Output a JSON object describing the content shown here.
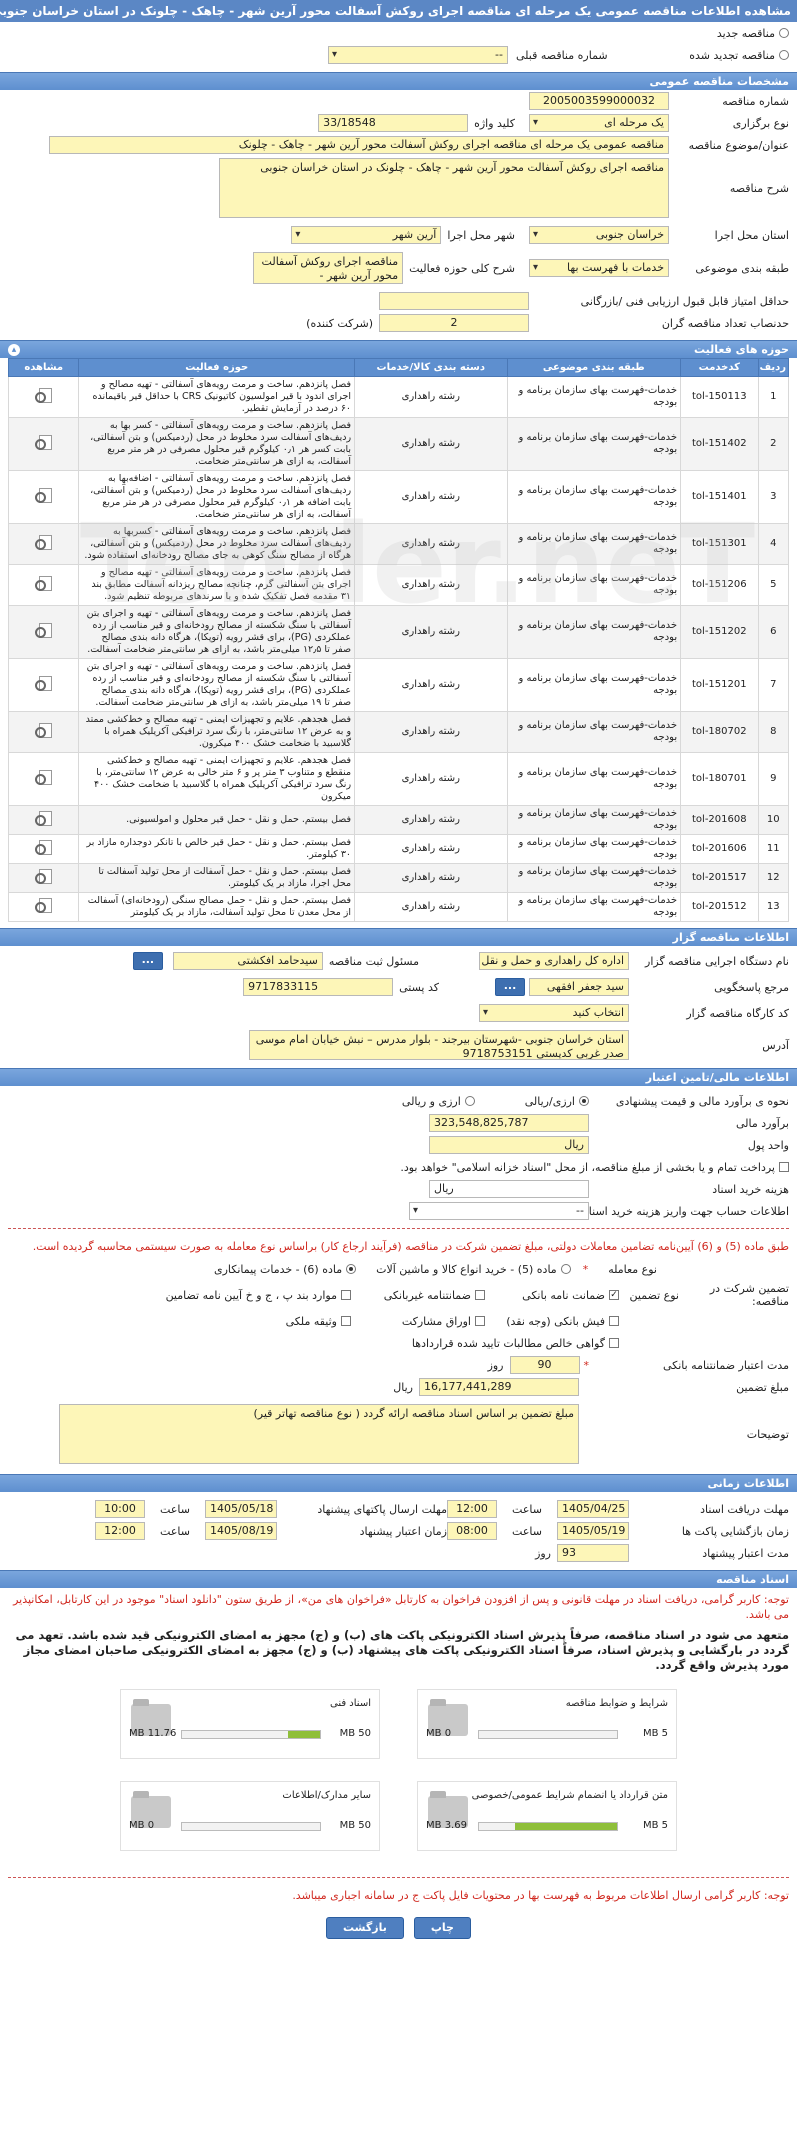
{
  "title": "مشاهده اطلاعات مناقصه عمومی یک مرحله ای مناقصه اجرای روکش آسفالت محور آرین شهر - چاهک - چلونک در استان خراسان جنوبی",
  "header_opts": {
    "new": "مناقصه جدید",
    "renewed": "مناقصه تجدید شده",
    "prev_no": "شماره مناقصه قبلی",
    "prev_val": "--"
  },
  "general": {
    "head": "مشخصات مناقصه عمومی",
    "no_lbl": "شماره مناقصه",
    "no": "2005003599000032",
    "type_lbl": "نوع برگزاری",
    "type": "یک مرحله ای",
    "kw_lbl": "کلید واژه",
    "kw": "33/18548",
    "subject_lbl": "عنوان/موضوع مناقصه",
    "subject": "مناقصه عمومی یک مرحله ای مناقصه اجرای روکش آسفالت محور آرین شهر - چاهک - چلونک",
    "desc_lbl": "شرح مناقصه",
    "desc": "مناقصه اجرای روکش آسفالت محور آرین شهر - چاهک - چلونک در استان خراسان جنوبی",
    "prov_lbl": "استان محل اجرا",
    "prov": "خراسان جنوبی",
    "city_lbl": "شهر محل اجرا",
    "city": "آرین شهر",
    "cat_lbl": "طبقه بندی موضوعی",
    "cat": "خدمات با فهرست بها",
    "scope_lbl": "شرح کلی حوزه فعالیت",
    "scope": "مناقصه اجرای روکش آسفالت محور آرین شهر -",
    "minscore_lbl": "حداقل امتیاز قابل قبول ارزیابی فنی /بازرگانی",
    "minscore": "",
    "minbid_lbl": "حدنصاب تعداد مناقصه گران",
    "minbid": "2",
    "minbid_unit": "(شرکت کننده)"
  },
  "activities": {
    "head": "حوزه های فعالیت",
    "cols": [
      "ردیف",
      "کدخدمت",
      "طبقه بندی موضوعی",
      "دسته بندی کالا/خدمات",
      "حوزه فعالیت",
      "مشاهده"
    ],
    "rows": [
      {
        "n": "1",
        "code": "tol-150113",
        "cat": "خدمات-فهرست بهای سازمان برنامه و بودجه",
        "grp": "رشته راهداری",
        "desc": "فصل پانزدهم. ساخت و مرمت رویه‌های آسفالتی - تهیه مصالح و اجرای اندود با قیر امولسیون کاتیونیک CRS با حداقل قیر باقیمانده ۶۰ درصد در آزمایش تقطیر."
      },
      {
        "n": "2",
        "code": "tol-151402",
        "cat": "خدمات-فهرست بهای سازمان برنامه و بودجه",
        "grp": "رشته راهداری",
        "desc": "فصل پانزدهم. ساخت و مرمت رویه‌های آسفالتی - کسر بها به ردیف‌های آسفالت سرد مخلوط در محل (ردمیکس) و بتن آسفالتی، بابت کسر هر ۰٫۱ کیلوگرم قیر محلول مصرفی در هر متر مربع آسفالت، به ازای هر سانتی‌متر ضخامت."
      },
      {
        "n": "3",
        "code": "tol-151401",
        "cat": "خدمات-فهرست بهای سازمان برنامه و بودجه",
        "grp": "رشته راهداری",
        "desc": "فصل پانزدهم. ساخت و مرمت رویه‌های آسفالتی - اضافه‌بها به ردیف‌های آسفالت سرد مخلوط در محل (ردمیکس) و بتن آسفالتی، بابت اضافه هر ۰٫۱ کیلوگرم قیر محلول مصرفی در هر متر مربع آسفالت، به ازای هر سانتی‌متر ضخامت."
      },
      {
        "n": "4",
        "code": "tol-151301",
        "cat": "خدمات-فهرست بهای سازمان برنامه و بودجه",
        "grp": "رشته راهداری",
        "desc": "فصل پانزدهم. ساخت و مرمت رویه‌های آسفالتی - کسربها به ردیف‌های آسفالت سرد مخلوط در محل (ردمیکس) و بتن آسفالتی، هرگاه از مصالح سنگ کوهی به جای مصالح رودخانه‌ای استفاده شود."
      },
      {
        "n": "5",
        "code": "tol-151206",
        "cat": "خدمات-فهرست بهای سازمان برنامه و بودجه",
        "grp": "رشته راهداری",
        "desc": "فصل پانزدهم. ساخت و مرمت رویه‌های آسفالتی - تهیه مصالح و اجرای بتن آسفالتی گرم، چنانچه مصالح ریزدانه آسفالت مطابق بند ۳۱ مقدمه فصل تفکیک شده و با سرندهای مربوطه تنظیم شود."
      },
      {
        "n": "6",
        "code": "tol-151202",
        "cat": "خدمات-فهرست بهای سازمان برنامه و بودجه",
        "grp": "رشته راهداری",
        "desc": "فصل پانزدهم. ساخت و مرمت رویه‌های آسفالتی - تهیه و اجرای بتن آسفالتی با سنگ شکسته از مصالح رودخانه‌ای و قیر مناسب از رده عملکردی (PG)، برای قشر رویه (توپکا)، هرگاه دانه بندی مصالح صفر تا ۱۲٫۵ میلی‌متر باشد، به ازای هر سانتی‌متر ضخامت آسفالت."
      },
      {
        "n": "7",
        "code": "tol-151201",
        "cat": "خدمات-فهرست بهای سازمان برنامه و بودجه",
        "grp": "رشته راهداری",
        "desc": "فصل پانزدهم. ساخت و مرمت رویه‌های آسفالتی - تهیه و اجرای بتن آسفالتی با سنگ شکسته از مصالح رودخانه‌ای و قیر مناسب از رده عملکردی (PG)، برای قشر رویه (توپکا)، هرگاه دانه بندی مصالح صفر تا ۱۹ میلی‌متر باشد، به ازای هر سانتی‌متر ضخامت آسفالت."
      },
      {
        "n": "8",
        "code": "tol-180702",
        "cat": "خدمات-فهرست بهای سازمان برنامه و بودجه",
        "grp": "رشته راهداری",
        "desc": "فصل هجدهم. علایم و تجهیزات ایمنی - تهیه مصالح و خط‌کشی ممتد و به عرض ۱۲ سانتی‌متر، با رنگ سرد ترافیکی آکریلیک همراه با گلاسبید با ضخامت خشک ۴۰۰ میکرون."
      },
      {
        "n": "9",
        "code": "tol-180701",
        "cat": "خدمات-فهرست بهای سازمان برنامه و بودجه",
        "grp": "رشته راهداری",
        "desc": "فصل هجدهم. علایم و تجهیزات ایمنی - تهیه مصالح و خط‌کشی منقطع و متناوب ۳ متر پر و ۶ متر خالی به عرض ۱۲ سانتی‌متر، با رنگ سرد ترافیکی آکریلیک همراه با گلاسبید با ضخامت خشک ۴۰۰ میکرون"
      },
      {
        "n": "10",
        "code": "tol-201608",
        "cat": "خدمات-فهرست بهای سازمان برنامه و بودجه",
        "grp": "رشته راهداری",
        "desc": "فصل بیستم. حمل و نقل - حمل قیر محلول و امولسیونی."
      },
      {
        "n": "11",
        "code": "tol-201606",
        "cat": "خدمات-فهرست بهای سازمان برنامه و بودجه",
        "grp": "رشته راهداری",
        "desc": "فصل بیستم. حمل و نقل - حمل قیر خالص با تانکر دوجداره مازاد بر ۳۰ کیلومتر."
      },
      {
        "n": "12",
        "code": "tol-201517",
        "cat": "خدمات-فهرست بهای سازمان برنامه و بودجه",
        "grp": "رشته راهداری",
        "desc": "فصل بیستم. حمل و نقل - حمل آسفالت از محل تولید آسفالت تا محل اجرا، مازاد بر یک کیلومتر."
      },
      {
        "n": "13",
        "code": "tol-201512",
        "cat": "خدمات-فهرست بهای سازمان برنامه و بودجه",
        "grp": "رشته راهداری",
        "desc": "فصل بیستم. حمل و نقل - حمل مصالح سنگی (رودخانه‌ای) آسفالت از محل معدن تا محل تولید آسفالت، مازاد بر یک کیلومتر"
      }
    ]
  },
  "organizer": {
    "head": "اطلاعات مناقصه گزار",
    "org_lbl": "نام دستگاه اجرایی مناقصه گزار",
    "org": "اداره کل راهداری و حمل و نقل",
    "resp_lbl": "مسئول ثبت مناقصه",
    "resp": "سیدحامد افکشتی",
    "ref_lbl": "مرجع پاسخگویی",
    "ref": "سید جعفر افقهی",
    "postal_lbl": "کد پستی",
    "postal": "9717833115",
    "workshop_lbl": "کد کارگاه مناقصه گزار",
    "workshop": "انتخاب کنید",
    "addr_lbl": "آدرس",
    "addr": "استان خراسان جنوبی -شهرستان بیرجند - بلوار مدرس – نبش خیابان امام موسی صدر غربی کدپستی 9718753151",
    "dots": "..."
  },
  "finance": {
    "head": "اطلاعات مالی/تامین اعتبار",
    "est_lbl": "نحوه ی برآورد مالی و قیمت پیشنهادی",
    "est_opt1": "ارزی/ریالی",
    "est_opt2": "ارزی و ریالی",
    "amount_lbl": "برآورد مالی",
    "amount": "323,548,825,787",
    "unit_lbl": "واحد پول",
    "unit": "ریال",
    "treasury": "پرداخت تمام و یا بخشی از مبلغ مناقصه، از محل \"اسناد خزانه اسلامی\" خواهد بود.",
    "doc_cost_lbl": "هزینه خرید اسناد",
    "doc_cost_unit": "ریال",
    "acct_lbl": "اطلاعات حساب جهت واریز هزینه خرید اسناد",
    "acct": "--"
  },
  "guarantee": {
    "red_note": "طبق ماده (5) و (6) آیین‌نامه تضامین معاملات دولتی، مبلغ تضمین شرکت در مناقصه (فرآیند ارجاع کار) براساس نوع معامله به صورت سیستمی محاسبه گردیده است.",
    "deal_lbl": "نوع معامله",
    "deal1": "ماده (5) - خرید انواع کالا و ماشین آلات",
    "deal2": "ماده (6) - خدمات پیمانکاری",
    "gtype_lbl": "تضمین شرکت در مناقصه:",
    "gtype_sub": "نوع تضمین",
    "g1": "ضمانت نامه بانکی",
    "g2": "ضمانتنامه غیربانکی",
    "g3": "موارد بند پ ، ج و خ آیین نامه تضامین",
    "g4": "فیش بانکی (وجه نقد)",
    "g5": "اوراق مشارکت",
    "g6": "وثیقه ملکی",
    "g7": "گواهی خالص مطالبات تایید شده قراردادها",
    "validity_lbl": "مدت اعتبار ضمانتنامه بانکی",
    "validity": "90",
    "validity_unit": "روز",
    "g_amount_lbl": "مبلغ تضمین",
    "g_amount": "16,177,441,289",
    "g_amount_unit": "ریال",
    "notes_lbl": "توضیحات",
    "notes": "مبلغ تضمین بر اساس اسناد مناقصه ارائه گردد ( نوع مناقصه تهاتر قیر)"
  },
  "timing": {
    "head": "اطلاعات زمانی",
    "recv_lbl": "مهلت دریافت اسناد",
    "recv_date": "1405/04/25",
    "recv_time": "12:00",
    "send_lbl": "مهلت ارسال پاکتهای پیشنهاد",
    "send_date": "1405/05/18",
    "send_time": "10:00",
    "open_lbl": "زمان بازگشایی پاکت ها",
    "open_date": "1405/05/19",
    "open_time": "08:00",
    "valid_lbl": "زمان اعتبار پیشنهاد",
    "valid_date": "1405/08/19",
    "valid_time": "12:00",
    "bidvalid_lbl": "مدت اعتبار پیشنهاد",
    "bidvalid": "93",
    "bidvalid_unit": "روز",
    "time_lbl": "ساعت"
  },
  "documents": {
    "head": "اسناد مناقصه",
    "red_note": "توجه: کاربر گرامی، دریافت اسناد در مهلت قانونی و پس از افزودن فراخوان به کارتابل «فراخوان های من»، از طریق ستون \"دانلود اسناد\" موجود در این کارتابل، امکانپذیر می باشد.",
    "bold_note": "متعهد می شود در اسناد مناقصه، صرفاً پذیرش اسناد الکترونیکی پاکت های (ب) و (ج) مجهز به امضای الکترونیکی قید شده باشد. تعهد می گردد در بارگشایی و پذیرش اسناد، صرفاً اسناد الکترونیکی پاکت های پیشنهاد (ب) و (ج) مجهز به امضای الکترونیکی صاحبان امضای مجاز مورد پذیرش واقع گردد.",
    "cards": [
      {
        "title": "شرایط و ضوابط مناقصه",
        "max": "5 MB",
        "cur": "0 MB",
        "pct": 0
      },
      {
        "title": "اسناد فنی",
        "max": "50 MB",
        "cur": "11.76 MB",
        "pct": 23.5
      },
      {
        "title": "متن قرارداد یا انضمام شرایط عمومی/خصوصی",
        "max": "5 MB",
        "cur": "3.69 MB",
        "pct": 73.8
      },
      {
        "title": "سایر مدارک/اطلاعات",
        "max": "50 MB",
        "cur": "0 MB",
        "pct": 0
      }
    ],
    "bottom_red": "توجه: کاربر گرامی ارسال اطلاعات مربوط به فهرست بها در محتویات فایل پاکت ج در سامانه اجباری میباشد."
  },
  "buttons": {
    "print": "چاپ",
    "back": "بازگشت"
  },
  "watermark": "Tender.neT"
}
